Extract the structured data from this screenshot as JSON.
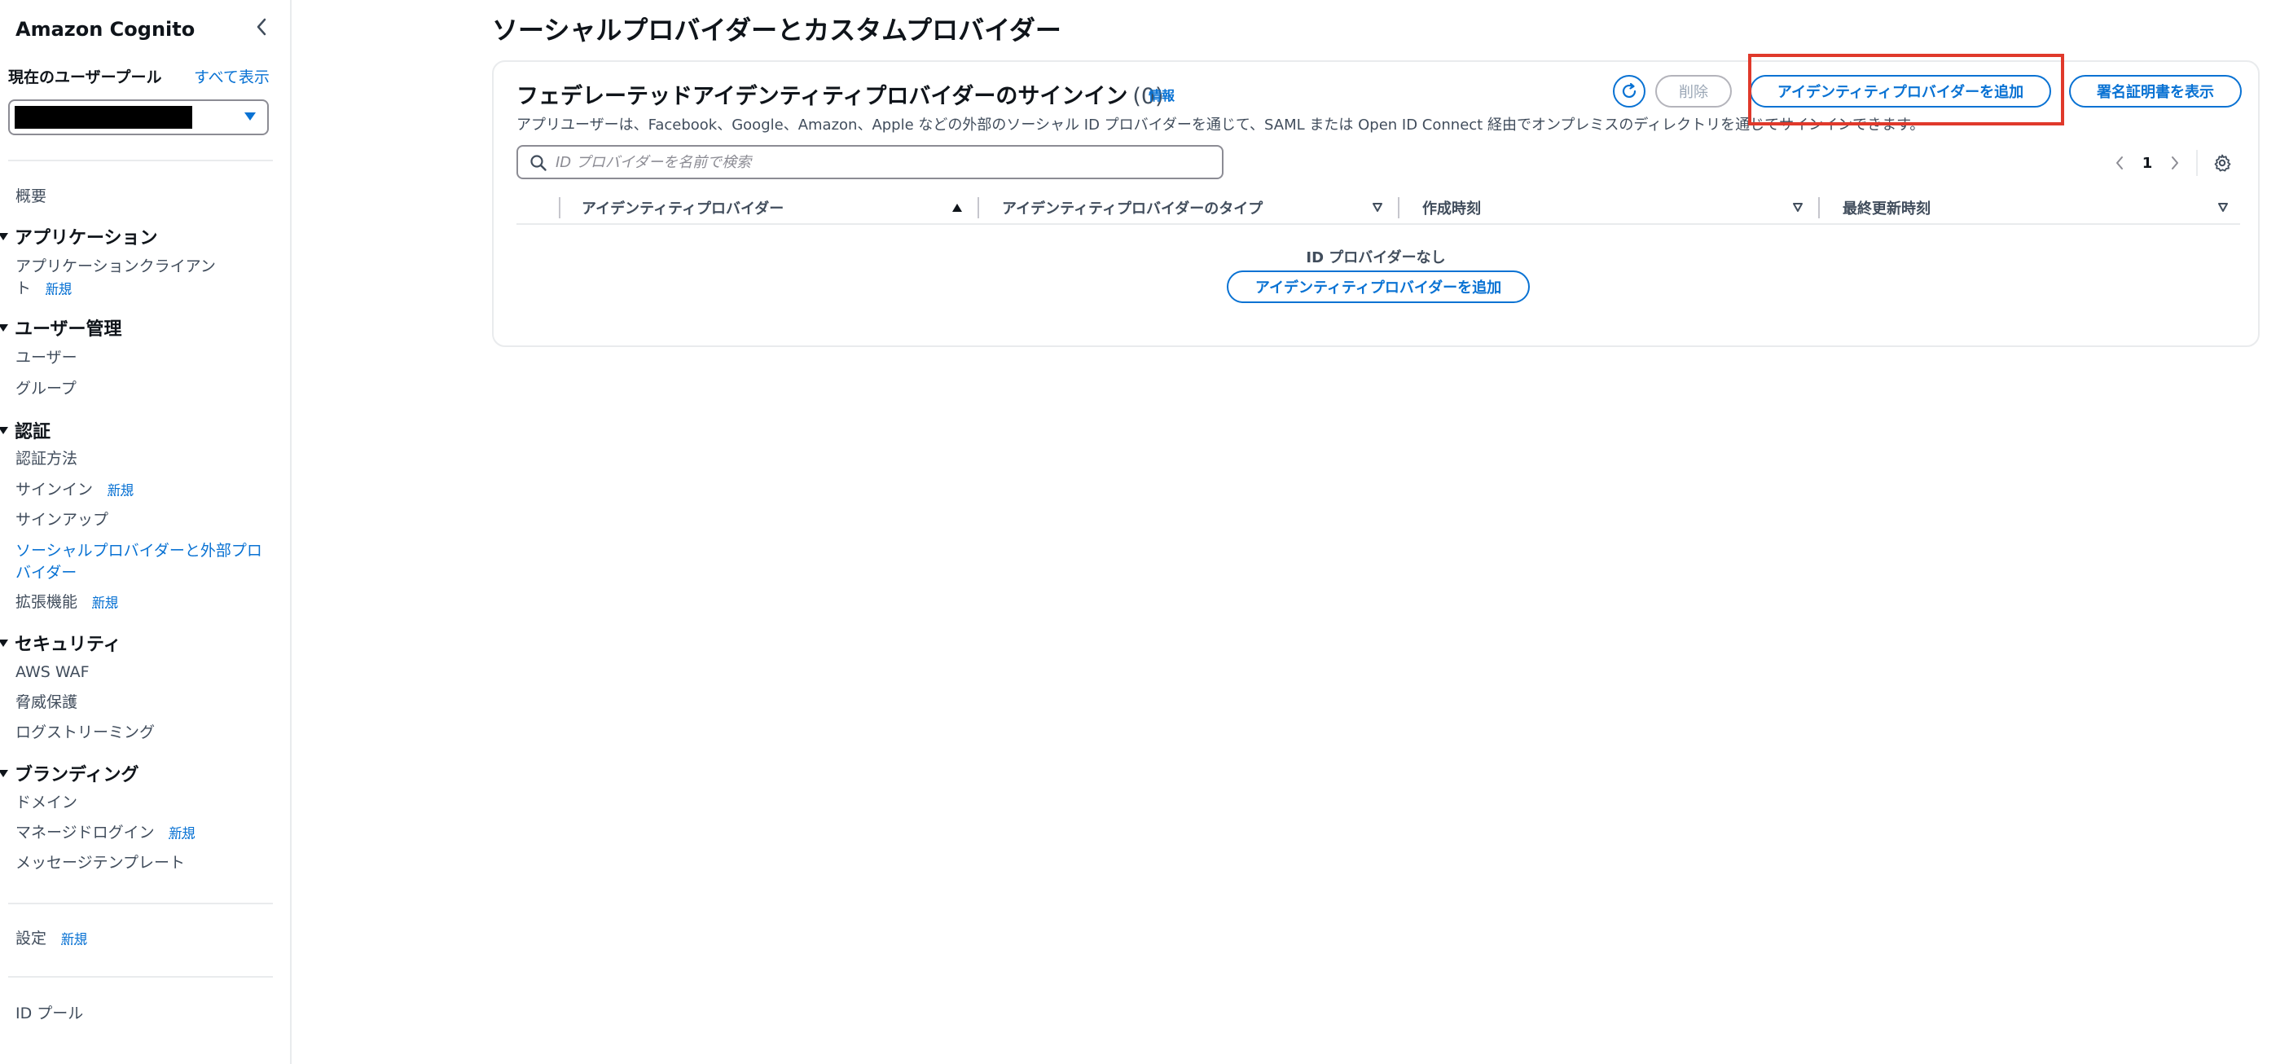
{
  "sidebar": {
    "title": "Amazon Cognito",
    "pool_label": "現在のユーザープール",
    "show_all": "すべて表示",
    "overview": "概要",
    "new_badge": "新規",
    "sections": {
      "application": {
        "heading": "アプリケーション",
        "app_client_line1": "アプリケーションクライアン",
        "app_client_line2": "ト"
      },
      "user_management": {
        "heading": "ユーザー管理",
        "users": "ユーザー",
        "groups": "グループ"
      },
      "authentication": {
        "heading": "認証",
        "methods": "認証方法",
        "sign_in": "サインイン",
        "sign_up": "サインアップ",
        "social_line1": "ソーシャルプロバイダーと外部プロ",
        "social_line2": "バイダー",
        "extensions": "拡張機能"
      },
      "security": {
        "heading": "セキュリティ",
        "waf": "AWS WAF",
        "threat": "脅威保護",
        "log_streaming": "ログストリーミング"
      },
      "branding": {
        "heading": "ブランディング",
        "domain": "ドメイン",
        "managed_login": "マネージドログイン",
        "message_templates": "メッセージテンプレート"
      }
    },
    "settings": "設定",
    "identity_pool": "ID プール"
  },
  "main": {
    "page_title": "ソーシャルプロバイダーとカスタムプロバイダー",
    "card": {
      "title": "フェデレーテッドアイデンティティプロバイダーのサインイン",
      "count": "(0)",
      "info": "情報",
      "description": "アプリユーザーは、Facebook、Google、Amazon、Apple などの外部のソーシャル ID プロバイダーを通じて、SAML または Open ID Connect 経由でオンプレミスのディレクトリを通じてサインインできます。",
      "delete_label": "削除",
      "add_provider_label": "アイデンティティプロバイダーを追加",
      "show_cert_label": "署名証明書を表示",
      "search_placeholder": "ID プロバイダーを名前で検索",
      "page_number": "1",
      "columns": [
        "アイデンティティプロバイダー",
        "アイデンティティプロバイダーのタイプ",
        "作成時刻",
        "最終更新時刻"
      ],
      "empty_title": "ID プロバイダーなし",
      "empty_add_label": "アイデンティティプロバイダーを追加"
    }
  },
  "colors": {
    "accent": "#0972d3",
    "highlight": "#e0392b",
    "text": "#0f141a",
    "muted": "#414d5c"
  }
}
